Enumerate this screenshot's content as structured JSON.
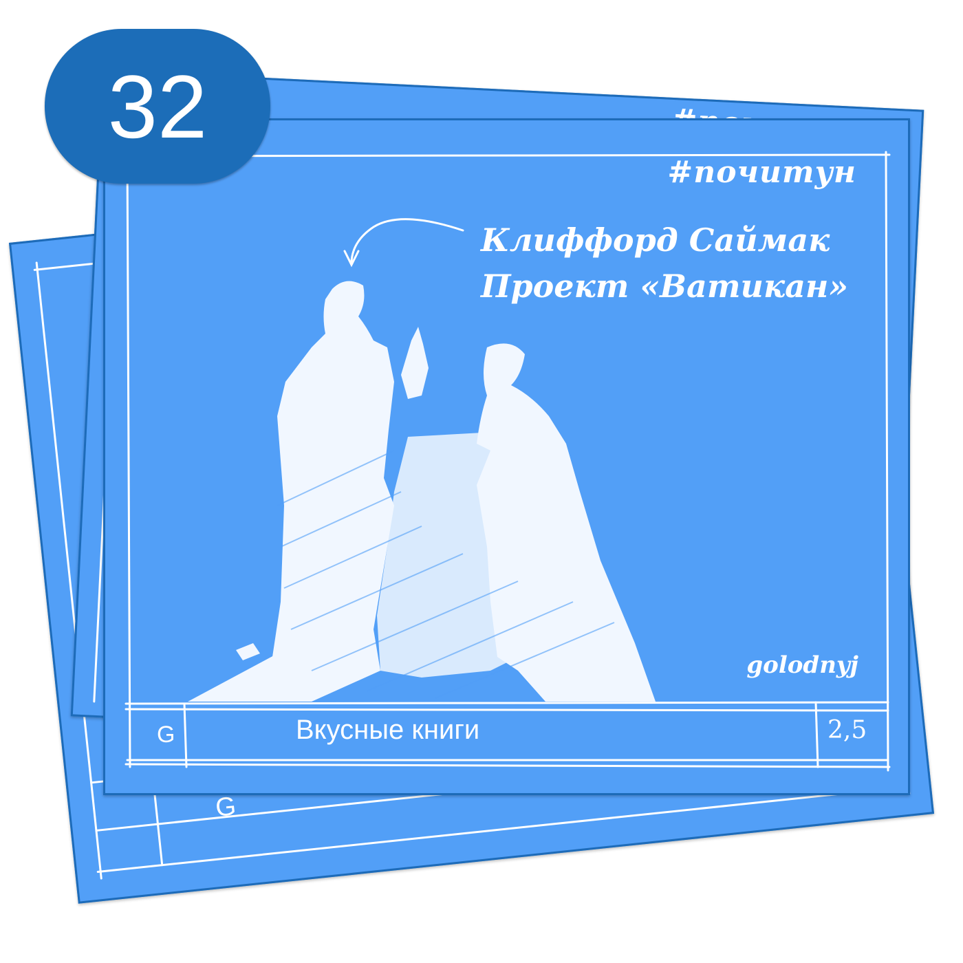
{
  "badge": {
    "number": "32"
  },
  "card": {
    "hashtag": "#почитун",
    "book_author": "Клиффорд Саймак",
    "book_title": "Проект «Ватикан»",
    "signature": "golodnyj",
    "series_name": "Вкусные книги",
    "category_letter": "G",
    "rating": "2,5"
  },
  "colors": {
    "card_blue": "#529ff7",
    "card_border": "#1d6bb8",
    "badge_blue": "#1c6db8",
    "ink": "#ffffff"
  },
  "illustration": {
    "icon": "two-figures-with-book-pile-sketch"
  }
}
